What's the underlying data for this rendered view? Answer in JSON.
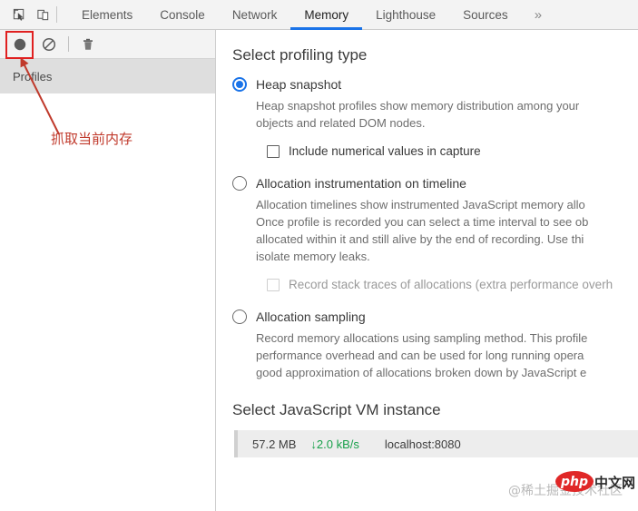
{
  "tabbar": {
    "icons": [
      {
        "name": "inspect-element-icon"
      },
      {
        "name": "device-toolbar-icon"
      }
    ],
    "tabs": [
      {
        "label": "Elements",
        "active": false
      },
      {
        "label": "Console",
        "active": false
      },
      {
        "label": "Network",
        "active": false
      },
      {
        "label": "Memory",
        "active": true
      },
      {
        "label": "Lighthouse",
        "active": false
      },
      {
        "label": "Sources",
        "active": false
      }
    ],
    "more_label": "»",
    "active_tab_color": "#1a73e8"
  },
  "sidebar": {
    "toolbar": {
      "record_title": "record-button",
      "clear_title": "clear-button",
      "delete_title": "delete-button"
    },
    "section_header": "Profiles",
    "highlight_color": "#e02020"
  },
  "annotation": {
    "text": "抓取当前内存",
    "color": "#c0392b"
  },
  "main": {
    "profiling_title": "Select profiling type",
    "options": [
      {
        "label": "Heap snapshot",
        "selected": true,
        "desc_lines": [
          "Heap snapshot profiles show memory distribution among your",
          "objects and related DOM nodes."
        ],
        "checkbox": {
          "label": "Include numerical values in capture",
          "checked": false,
          "disabled": false
        }
      },
      {
        "label": "Allocation instrumentation on timeline",
        "selected": false,
        "desc_lines": [
          "Allocation timelines show instrumented JavaScript memory allo",
          "Once profile is recorded you can select a time interval to see ob",
          "allocated within it and still alive by the end of recording. Use thi",
          "isolate memory leaks."
        ],
        "checkbox": {
          "label": "Record stack traces of allocations (extra performance overh",
          "checked": false,
          "disabled": true
        }
      },
      {
        "label": "Allocation sampling",
        "selected": false,
        "desc_lines": [
          "Record memory allocations using sampling method. This profile",
          "performance overhead and can be used for long running opera",
          "good approximation of allocations broken down by JavaScript e"
        ],
        "checkbox": null
      }
    ],
    "vm_title": "Select JavaScript VM instance",
    "vm_row": {
      "size": "57.2 MB",
      "rate": "↓2.0 kB/s",
      "rate_color": "#18a04a",
      "host": "localhost:8080"
    }
  },
  "watermarks": {
    "gray": "@稀土掘金技术社区",
    "php": "php",
    "cn": "中文网"
  }
}
